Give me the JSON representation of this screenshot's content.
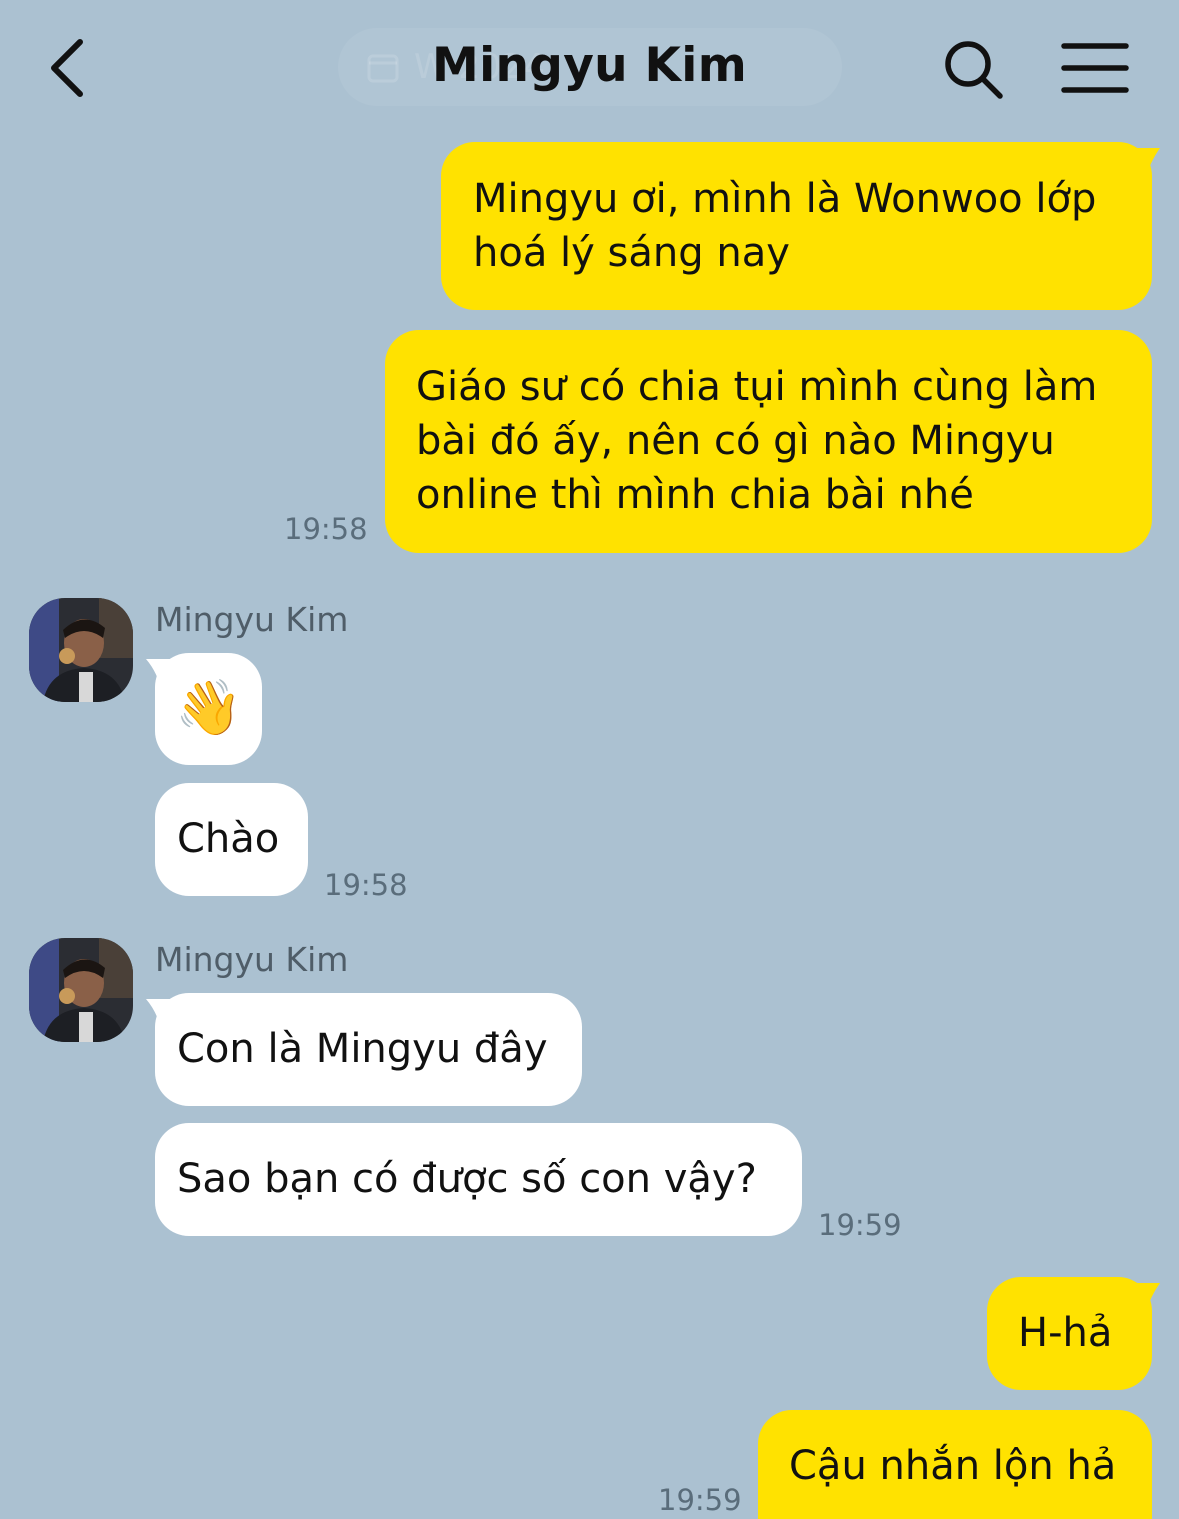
{
  "header": {
    "title": "Mingyu Kim",
    "date_pill_text": "W                    2024"
  },
  "messages": {
    "m1": {
      "text_line1": "Mingyu ơi, mình là Wonwoo lớp",
      "text_line2": "hoá lý sáng nay"
    },
    "m2": {
      "text_line1": "Giáo sư có chia tụi mình cùng làm",
      "text_line2": "bài đó ấy, nên có gì nào Mingyu",
      "text_line3": "online thì mình chia bài nhé",
      "time": "19:58"
    },
    "g1": {
      "sender": "Mingyu Kim",
      "emoji": "👋",
      "text": "Chào",
      "time": "19:58"
    },
    "g2": {
      "sender": "Mingyu Kim",
      "text1": "Con là Mingyu đây",
      "text2": "Sao bạn có được số con vậy?",
      "time": "19:59"
    },
    "m3": {
      "text": "H-hả"
    },
    "m4": {
      "text": "Cậu nhắn lộn hả",
      "time": "19:59"
    }
  },
  "icons": {
    "back": "chevron-left-icon",
    "search": "search-icon",
    "menu": "hamburger-menu-icon",
    "calendar": "calendar-icon",
    "wave": "waving-hand-emoji"
  },
  "colors": {
    "background": "#abc1d1",
    "my_bubble": "#ffe200",
    "their_bubble": "#ffffff"
  }
}
